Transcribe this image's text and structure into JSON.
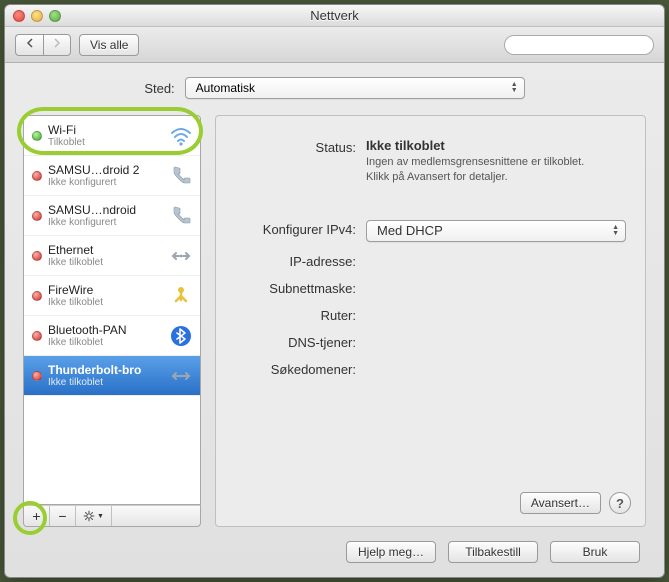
{
  "window": {
    "title": "Nettverk"
  },
  "toolbar": {
    "show_all": "Vis alle",
    "search_placeholder": ""
  },
  "location": {
    "label": "Sted:",
    "value": "Automatisk"
  },
  "services": [
    {
      "name": "Wi-Fi",
      "status": "Tilkoblet",
      "dot": "green",
      "icon": "wifi",
      "selected": false
    },
    {
      "name": "SAMSU…droid 2",
      "status": "Ikke konfigurert",
      "dot": "red",
      "icon": "phone",
      "selected": false
    },
    {
      "name": "SAMSU…ndroid",
      "status": "Ikke konfigurert",
      "dot": "red",
      "icon": "phone",
      "selected": false
    },
    {
      "name": "Ethernet",
      "status": "Ikke tilkoblet",
      "dot": "red",
      "icon": "ethernet",
      "selected": false
    },
    {
      "name": "FireWire",
      "status": "Ikke tilkoblet",
      "dot": "red",
      "icon": "firewire",
      "selected": false
    },
    {
      "name": "Bluetooth-PAN",
      "status": "Ikke tilkoblet",
      "dot": "red",
      "icon": "bluetooth",
      "selected": false
    },
    {
      "name": "Thunderbolt-bro",
      "status": "Ikke tilkoblet",
      "dot": "red",
      "icon": "ethernet",
      "selected": true
    }
  ],
  "detail": {
    "status_label": "Status:",
    "status_value": "Ikke tilkoblet",
    "status_desc_1": "Ingen av medlemsgrensesnittene er tilkoblet.",
    "status_desc_2": "Klikk på Avansert for detaljer.",
    "config_label": "Konfigurer IPv4:",
    "config_value": "Med DHCP",
    "ip_label": "IP-adresse:",
    "ip_value": "",
    "subnet_label": "Subnettmaske:",
    "subnet_value": "",
    "router_label": "Ruter:",
    "router_value": "",
    "dns_label": "DNS-tjener:",
    "dns_value": "",
    "search_label": "Søkedomener:",
    "search_value": "",
    "advanced": "Avansert…"
  },
  "footer": {
    "help": "Hjelp meg…",
    "revert": "Tilbakestill",
    "apply": "Bruk"
  }
}
